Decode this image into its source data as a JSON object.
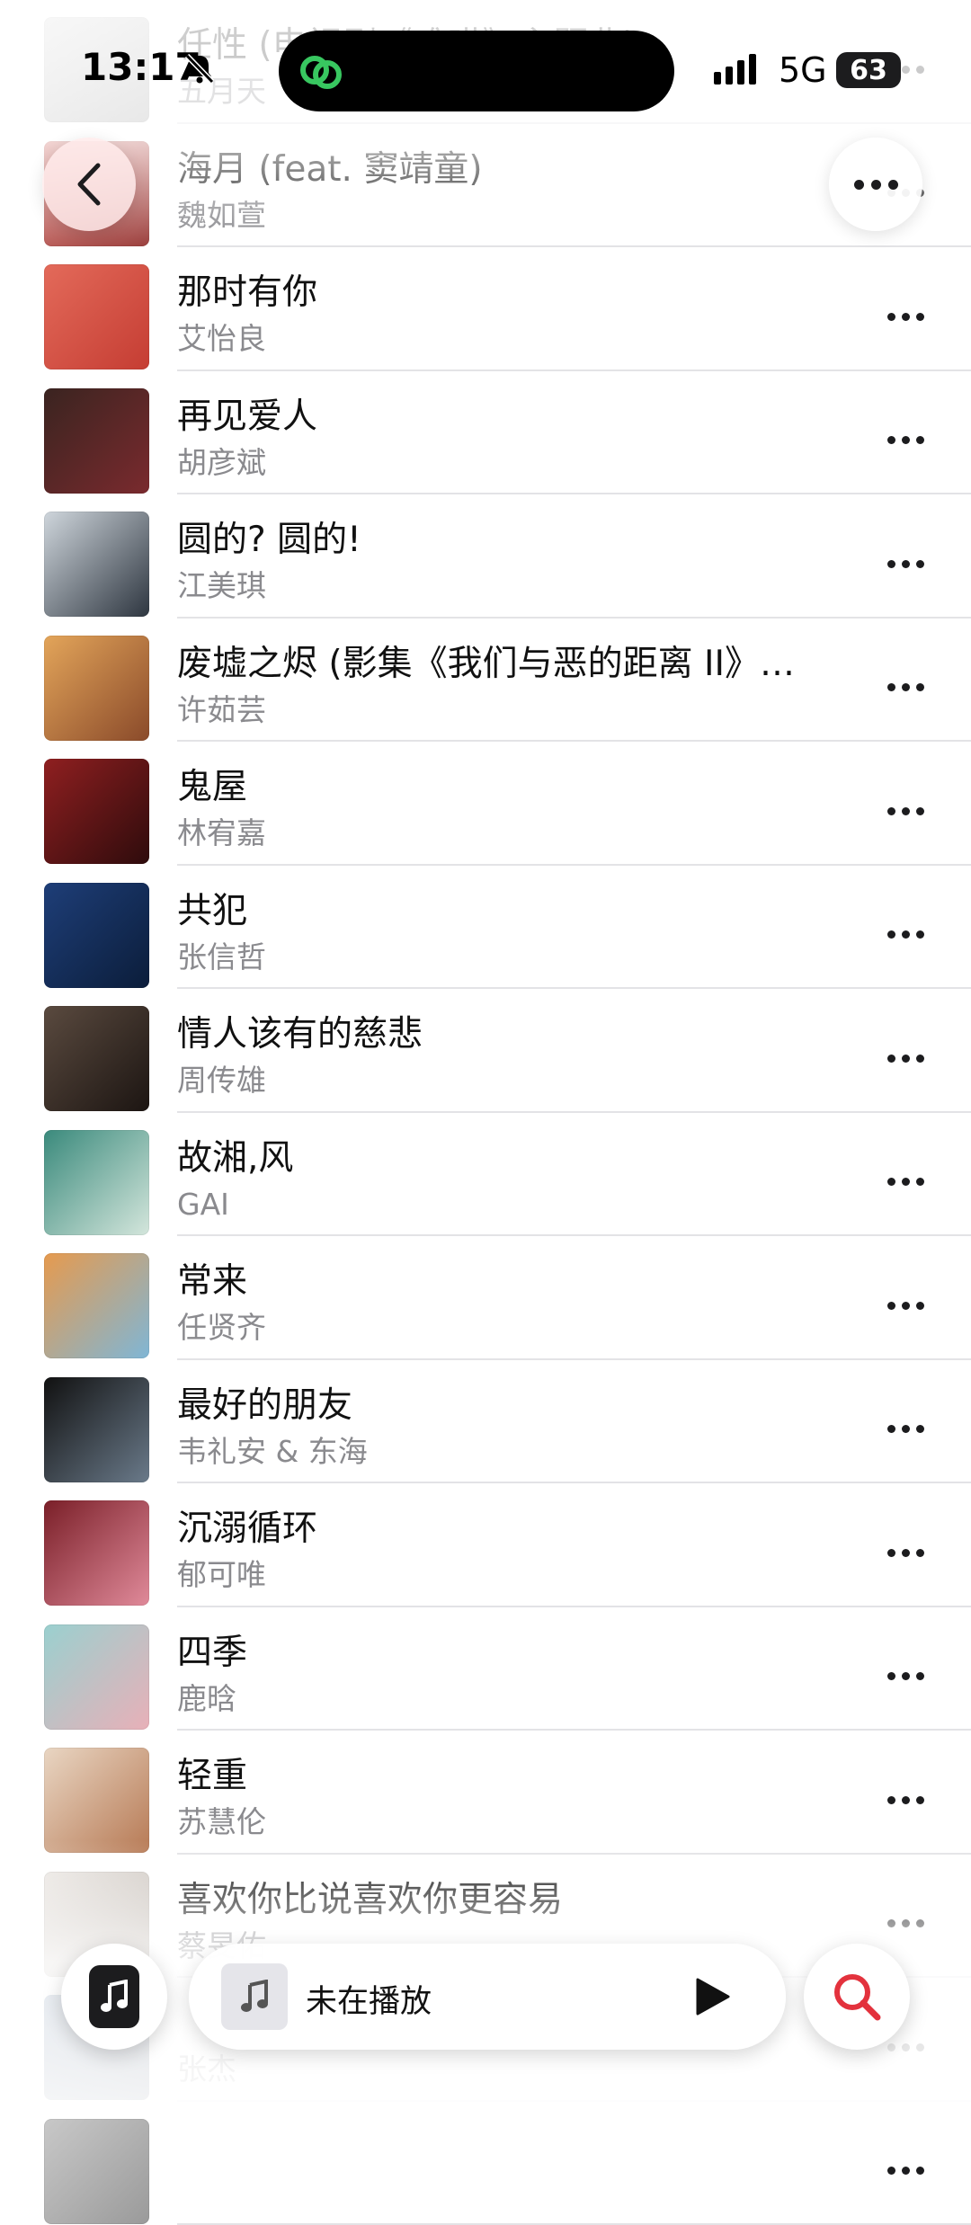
{
  "status_bar": {
    "time": "13:17",
    "network": "5G",
    "battery": "63"
  },
  "songs": [
    {
      "title": "任性 (电视剧《难哄》主题曲)",
      "artist": "五月天",
      "art_colors": [
        "#d8d8d8",
        "#a9a9a9"
      ]
    },
    {
      "title": "海月 (feat. 窦靖童)",
      "artist": "魏如萱",
      "art_colors": [
        "#d77a74",
        "#9a3e3c"
      ]
    },
    {
      "title": "那时有你",
      "artist": "艾怡良",
      "art_colors": [
        "#e36a5a",
        "#c53d33"
      ]
    },
    {
      "title": "再见爱人",
      "artist": "胡彦斌",
      "art_colors": [
        "#3a2420",
        "#7a2a2e"
      ]
    },
    {
      "title": "圆的? 圆的!",
      "artist": "江美琪",
      "art_colors": [
        "#cfd6dc",
        "#2e3640"
      ]
    },
    {
      "title": "废墟之烬 (影集《我们与恶的距离 II》片尾曲)",
      "artist": "许茹芸",
      "art_colors": [
        "#e3a55a",
        "#8a4a2a"
      ]
    },
    {
      "title": "鬼屋",
      "artist": "林宥嘉",
      "art_colors": [
        "#8f1f20",
        "#2e0b0c"
      ]
    },
    {
      "title": "共犯",
      "artist": "张信哲",
      "art_colors": [
        "#1e3e78",
        "#0b1d3a"
      ]
    },
    {
      "title": "情人该有的慈悲",
      "artist": "周传雄",
      "art_colors": [
        "#5a4a3f",
        "#1c1512"
      ]
    },
    {
      "title": "故湘,风",
      "artist": "GAI",
      "art_colors": [
        "#3a8a7c",
        "#d4e6dc"
      ]
    },
    {
      "title": "常来",
      "artist": "任贤齐",
      "art_colors": [
        "#e69a4e",
        "#7fb6d6"
      ]
    },
    {
      "title": "最好的朋友",
      "artist": "韦礼安 & 东海",
      "art_colors": [
        "#111111",
        "#6a7a8a"
      ]
    },
    {
      "title": "沉溺循环",
      "artist": "郁可唯",
      "art_colors": [
        "#7a1f28",
        "#e08a9a"
      ]
    },
    {
      "title": "四季",
      "artist": "鹿晗",
      "art_colors": [
        "#9ad0cf",
        "#e8b0b8"
      ]
    },
    {
      "title": "轻重",
      "artist": "苏慧伦",
      "art_colors": [
        "#e9d6c3",
        "#b77a55"
      ]
    },
    {
      "title": "喜欢你比说喜欢你更容易",
      "artist": "蔡旻佑",
      "art_colors": [
        "#eae6e2",
        "#b9b0a8"
      ]
    },
    {
      "title": "",
      "artist": "张杰",
      "art_colors": [
        "#6d86a8",
        "#2d3b52"
      ]
    },
    {
      "title": "",
      "artist": "",
      "art_colors": [
        "#c8c8c8",
        "#9a9a9a"
      ]
    }
  ],
  "mini_player": {
    "label": "未在播放"
  },
  "colors": {
    "accent": "#e3323d",
    "divider": "#e3e3e6",
    "secondary_text": "#8a8a8e"
  },
  "icons": {
    "back": "chevron-left-icon",
    "more": "ellipsis-icon",
    "music_tab": "music-note-icon",
    "play": "play-icon",
    "search": "search-icon",
    "silent": "bell-slash-icon",
    "activity": "link-icon"
  }
}
